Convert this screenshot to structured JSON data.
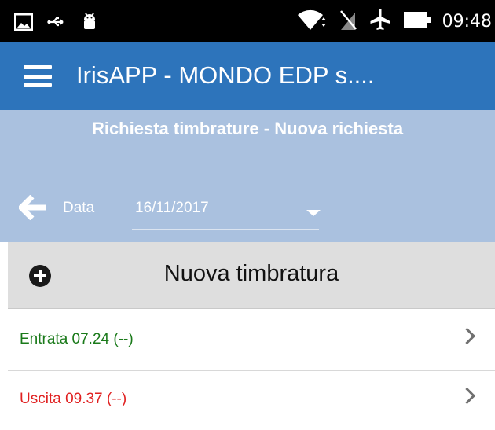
{
  "status_bar": {
    "time": "09:48",
    "icons_left": [
      "image-icon",
      "usb-icon",
      "android-icon"
    ],
    "icons_right": [
      "wifi-icon",
      "no-sim-icon",
      "airplane-icon",
      "battery-icon"
    ]
  },
  "app_bar": {
    "title": "IrisAPP - MONDO EDP s....",
    "menu_icon": "hamburger-menu-icon"
  },
  "section": {
    "title": "Richiesta timbrature - Nuova richiesta"
  },
  "date_bar": {
    "label": "Data",
    "value": "16/11/2017"
  },
  "new_button": {
    "label": "Nuova timbratura"
  },
  "entries": [
    {
      "label": "Entrata 07.24 (--)",
      "color": "#1a7a1a"
    },
    {
      "label": "Uscita 09.37 (--)",
      "color": "#e02020"
    }
  ],
  "colors": {
    "app_bar": "#2d74bb",
    "section_bg": "#aac1df",
    "button_bg": "#dedede"
  }
}
